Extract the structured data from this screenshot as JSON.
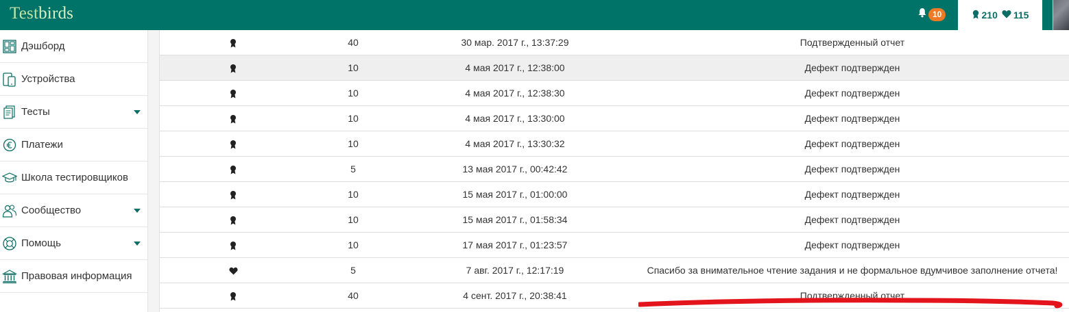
{
  "header": {
    "logo_part1": "Test",
    "logo_part2": "birds",
    "notifications_count": "10",
    "points": "210",
    "likes": "115"
  },
  "sidebar": {
    "items": [
      {
        "label": "Дэшборд",
        "icon": "dashboard-icon",
        "has_caret": false
      },
      {
        "label": "Устройства",
        "icon": "devices-icon",
        "has_caret": false
      },
      {
        "label": "Тесты",
        "icon": "tests-icon",
        "has_caret": true
      },
      {
        "label": "Платежи",
        "icon": "euro-icon",
        "has_caret": false
      },
      {
        "label": "Школа тестировщиков",
        "icon": "graduation-cap-icon",
        "has_caret": false
      },
      {
        "label": "Сообщество",
        "icon": "community-icon",
        "has_caret": true
      },
      {
        "label": "Помощь",
        "icon": "lifebuoy-icon",
        "has_caret": true
      },
      {
        "label": "Правовая информация",
        "icon": "legal-icon",
        "has_caret": false
      }
    ]
  },
  "table": {
    "rows": [
      {
        "type": "award",
        "points": "40",
        "date": "30 мар. 2017 г., 13:37:29",
        "reason": "Подтвержденный отчет"
      },
      {
        "type": "award",
        "points": "10",
        "date": "4 мая 2017 г., 12:38:00",
        "reason": "Дефект подтвержден"
      },
      {
        "type": "award",
        "points": "10",
        "date": "4 мая 2017 г., 12:38:30",
        "reason": "Дефект подтвержден"
      },
      {
        "type": "award",
        "points": "10",
        "date": "4 мая 2017 г., 13:30:00",
        "reason": "Дефект подтвержден"
      },
      {
        "type": "award",
        "points": "10",
        "date": "4 мая 2017 г., 13:30:32",
        "reason": "Дефект подтвержден"
      },
      {
        "type": "award",
        "points": "5",
        "date": "13 мая 2017 г., 00:42:42",
        "reason": "Дефект подтвержден"
      },
      {
        "type": "award",
        "points": "10",
        "date": "15 мая 2017 г., 01:00:00",
        "reason": "Дефект подтвержден"
      },
      {
        "type": "award",
        "points": "10",
        "date": "15 мая 2017 г., 01:58:34",
        "reason": "Дефект подтвержден"
      },
      {
        "type": "award",
        "points": "10",
        "date": "17 мая 2017 г., 01:23:57",
        "reason": "Дефект подтвержден"
      },
      {
        "type": "heart",
        "points": "5",
        "date": "7 авг. 2017 г., 12:17:19",
        "reason": "Спасибо за внимательное чтение задания и не формальное вдумчивое заполнение отчета!"
      },
      {
        "type": "award",
        "points": "40",
        "date": "4 сент. 2017 г., 20:38:41",
        "reason": "Подтвержденный отчет"
      }
    ],
    "highlighted_row": 1
  },
  "colors": {
    "brand": "#007369",
    "badge": "#f07a24",
    "annotation": "#e3141c"
  }
}
